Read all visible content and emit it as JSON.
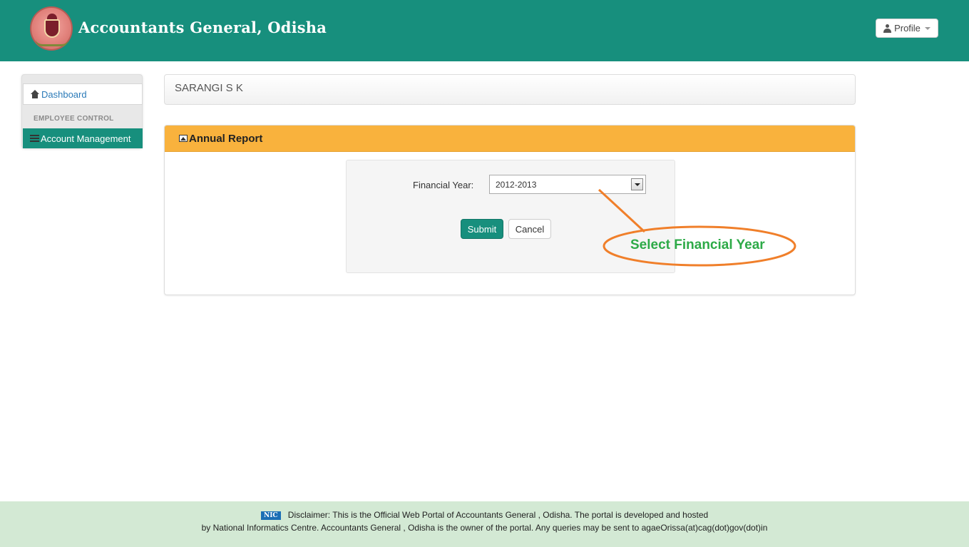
{
  "header": {
    "title": "Accountants General, Odisha",
    "profile_label": "Profile"
  },
  "sidebar": {
    "dashboard_label": "Dashboard",
    "section_label": "EMPLOYEE CONTROL",
    "account_label": "Account Management"
  },
  "user": {
    "name": "SARANGI S K"
  },
  "panel": {
    "title": "Annual Report",
    "financial_year_label": "Financial Year:",
    "financial_year_value": "2012-2013",
    "submit_label": "Submit",
    "cancel_label": "Cancel"
  },
  "annotation": {
    "text": "Select Financial Year",
    "color": "#f07f2a",
    "text_color": "#2daa47"
  },
  "footer": {
    "logo_text": "NIC",
    "line1": "Disclaimer: This is the Official Web Portal of Accountants General , Odisha. The portal is developed and hosted",
    "line2": "by National Informatics Centre. Accountants General , Odisha is the owner of the portal. Any queries may be sent to agaeOrissa(at)cag(dot)gov(dot)in"
  },
  "colors": {
    "header_bg": "#178f7d",
    "panel_head_bg": "#f9b23d",
    "footer_bg": "#d3e9d4",
    "link": "#2a7ab8"
  }
}
